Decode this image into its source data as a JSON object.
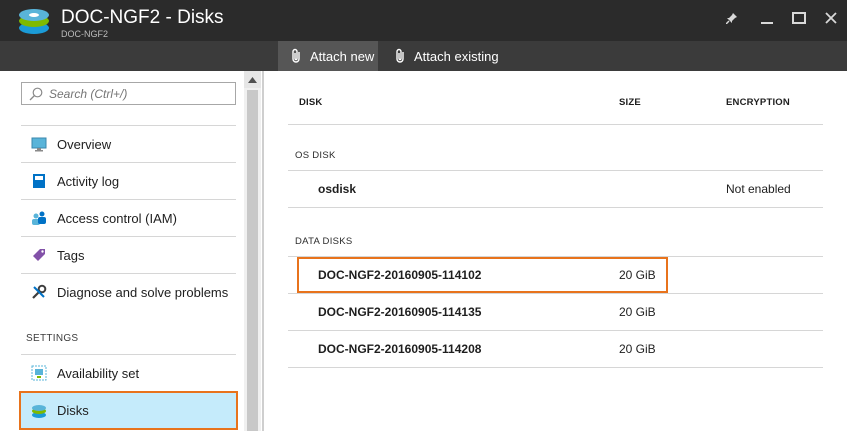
{
  "header": {
    "title": "DOC-NGF2 - Disks",
    "subtitle": "DOC-NGF2"
  },
  "commands": [
    {
      "label": "Attach new",
      "icon": "paperclip-icon"
    },
    {
      "label": "Attach existing",
      "icon": "paperclip-icon"
    }
  ],
  "search": {
    "placeholder": "Search (Ctrl+/)"
  },
  "nav": {
    "items": [
      {
        "label": "Overview",
        "icon": "monitor-icon"
      },
      {
        "label": "Activity log",
        "icon": "log-book-icon"
      },
      {
        "label": "Access control (IAM)",
        "icon": "users-icon"
      },
      {
        "label": "Tags",
        "icon": "tag-icon"
      },
      {
        "label": "Diagnose and solve problems",
        "icon": "wrench-icon"
      }
    ],
    "section": "SETTINGS",
    "settings_items": [
      {
        "label": "Availability set",
        "icon": "availability-set-icon"
      },
      {
        "label": "Disks",
        "icon": "disks-icon",
        "selected": true
      }
    ]
  },
  "table": {
    "headers": {
      "disk": "DISK",
      "size": "SIZE",
      "encryption": "ENCRYPTION"
    },
    "os_group": "OS DISK",
    "os_disk": {
      "name": "osdisk",
      "size": "",
      "encryption": "Not enabled"
    },
    "data_group": "DATA DISKS",
    "data_disks": [
      {
        "name": "DOC-NGF2-20160905-114102",
        "size": "20 GiB"
      },
      {
        "name": "DOC-NGF2-20160905-114135",
        "size": "20 GiB"
      },
      {
        "name": "DOC-NGF2-20160905-114208",
        "size": "20 GiB"
      }
    ]
  },
  "colors": {
    "header_bg": "#2b2b2b",
    "command_bar_bg": "#3b3b3b",
    "highlight_border": "#e8731c",
    "selected_bg": "#c5ebfb"
  }
}
